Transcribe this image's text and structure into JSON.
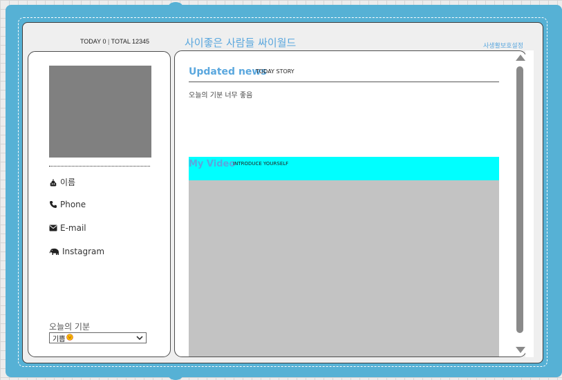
{
  "counter": {
    "today_label": "TODAY 0",
    "separator": "|",
    "total_label": "TOTAL 12345"
  },
  "site_title": "사이좋은 사람들 싸이월드",
  "settings_link": "사생활보호설정",
  "profile": {
    "items": [
      {
        "icon": "poop-icon",
        "label": "이름"
      },
      {
        "icon": "phone-icon",
        "label": "Phone"
      },
      {
        "icon": "envelope-icon",
        "label": "E-mail"
      },
      {
        "icon": "elephant-icon",
        "label": "Instagram"
      }
    ],
    "mood_label": "오늘의 기분",
    "mood_selected": "기쁨"
  },
  "news": {
    "title": "Updated news",
    "subtitle": "TODAY STORY",
    "text": "오늘의 기분 너무 좋음"
  },
  "video": {
    "title": "My Video",
    "subtitle": "INTRODUCE YOURSELF"
  },
  "colors": {
    "binder": "#56b1d5",
    "accent": "#5aa7de",
    "video_header": "#00ffff",
    "photo_placeholder": "#808080",
    "video_placeholder": "#c3c3c3"
  }
}
